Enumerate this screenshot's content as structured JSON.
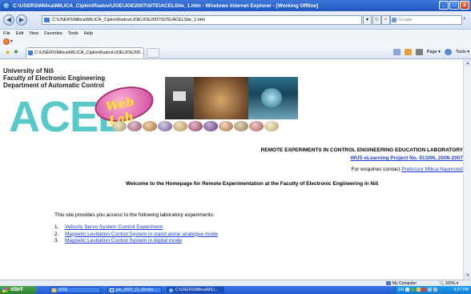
{
  "window": {
    "title": "C:\\USERS\\Milica\\MILICA_Cipkin\\Radovi\\JOE\\JOE2007\\SITE\\ACELSite_1.htm - Windows Internet Explorer - [Working Offline]",
    "controls": [
      "_",
      "□",
      "x"
    ]
  },
  "addressbar": {
    "url": "C:\\USERS\\Milica\\MILICA_Cipkin\\Radovi\\JOE\\JOE2007\\SITE\\ACELSite_1.htm",
    "search_placeholder": "Google",
    "refresh": "↻",
    "stop": "×"
  },
  "menu": [
    "File",
    "Edit",
    "View",
    "Favorites",
    "Tools",
    "Help"
  ],
  "tab": {
    "label": "C:\\USERS\\Milica\\MILICA_Cipkin\\Radovi\\JOE\\JOE200...",
    "page_label": "Page ▾",
    "tools_label": "Tools ▾"
  },
  "page": {
    "university": [
      "University of Niš",
      "Faculty of Electronic Engineering",
      "Department of Automatic Control"
    ],
    "acel": "ACEL",
    "weblab": "Web Lab",
    "lab_title": "REMOTE EXPERIMENTS IN CONTROL ENGINEERING EDUCATION LABORATORY",
    "wus_link": "WUS eLearning Project No. 013/06, 2006-2007",
    "enquiries_prefix": "For enquiries contact ",
    "enquiries_link": "Professor Milica Naumović",
    "welcome": "Welcome to the Homepage for Remote Experimentation at the Faculty of Electronic Engineering in Niš",
    "intro": "This site provides you access to the following laboratory experiments:",
    "experiments": [
      {
        "num": "1.",
        "label": "Velocity Servo System Control Experiment"
      },
      {
        "num": "2.",
        "label": "Magnetic Levitation Control System in stand alone analogue mode"
      },
      {
        "num": "3.",
        "label": "Magnetic Levitation Control System in digital mode"
      }
    ]
  },
  "statusbar": {
    "zone": "My Computer",
    "zoom": "100%"
  },
  "taskbar": {
    "start": "start",
    "tasks": [
      "SITE",
      "joe_2007_11_09.doc...",
      "C:\\USERS\\Milica\\MILI..."
    ],
    "lang": "EN",
    "clock": "9:27 PM"
  },
  "colors": {
    "link": "#1a3ed6",
    "acel": "#57c9c9",
    "weblab": "#d1439a"
  }
}
